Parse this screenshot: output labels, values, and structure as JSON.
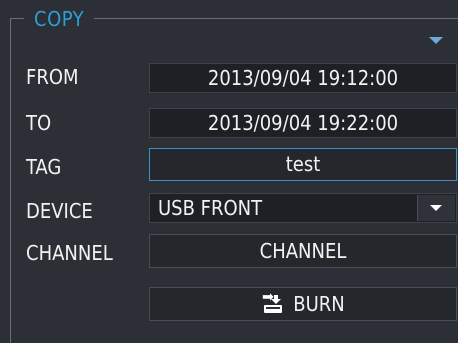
{
  "panel": {
    "title": "COPY",
    "accent_color": "#2e9fd6",
    "collapse_icon": "triangle-down-icon"
  },
  "rows": {
    "from_label": "FROM",
    "from_value": "2013/09/04 19:12:00",
    "to_label": "TO",
    "to_value": "2013/09/04 19:22:00",
    "tag_label": "TAG",
    "tag_value": "test",
    "device_label": "DEVICE",
    "device_value": "USB FRONT",
    "device_icon": "chevron-down-icon",
    "channel_label": "CHANNEL",
    "channel_button": "CHANNEL"
  },
  "actions": {
    "burn_label": "BURN",
    "burn_icon": "burn-disc-icon"
  }
}
